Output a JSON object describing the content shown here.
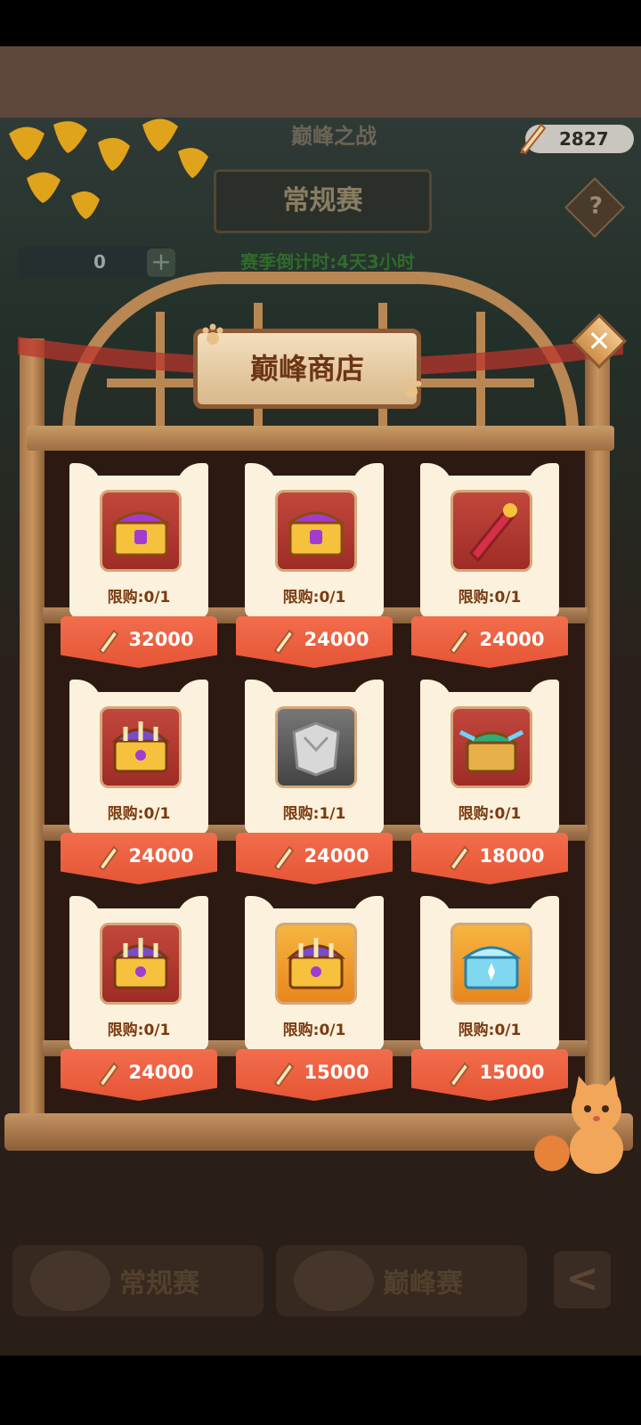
{
  "header": {
    "battle_title": "巅峰之战",
    "mode_title": "常规赛",
    "countdown": "赛季倒计时:4天3小时",
    "currency_value": "2827",
    "energy_value": "0",
    "help_label": "?"
  },
  "shop": {
    "title": "巅峰商店",
    "close_label": "✕",
    "items": [
      {
        "limit": "限购:0/1",
        "price": "32000",
        "icon": "purple-gold-chest",
        "style": "red"
      },
      {
        "limit": "限购:0/1",
        "price": "24000",
        "icon": "purple-gold-chest",
        "style": "red"
      },
      {
        "limit": "限购:0/1",
        "price": "24000",
        "icon": "red-scroll-scepter",
        "style": "red"
      },
      {
        "limit": "限购:0/1",
        "price": "24000",
        "icon": "striped-treasure-chest",
        "style": "red"
      },
      {
        "limit": "限购:1/1",
        "price": "24000",
        "icon": "silver-armor",
        "style": "grey"
      },
      {
        "limit": "限购:0/1",
        "price": "18000",
        "icon": "jade-winged-chest",
        "style": "red"
      },
      {
        "limit": "限购:0/1",
        "price": "24000",
        "icon": "striped-treasure-chest",
        "style": "red"
      },
      {
        "limit": "限购:0/1",
        "price": "15000",
        "icon": "striped-treasure-chest",
        "style": "orange"
      },
      {
        "limit": "限购:0/1",
        "price": "15000",
        "icon": "crystal-blue-chest",
        "style": "orange"
      }
    ]
  },
  "bottom_tabs": [
    {
      "label": "常规赛"
    },
    {
      "label": "巅峰赛"
    }
  ],
  "back_label": "<"
}
